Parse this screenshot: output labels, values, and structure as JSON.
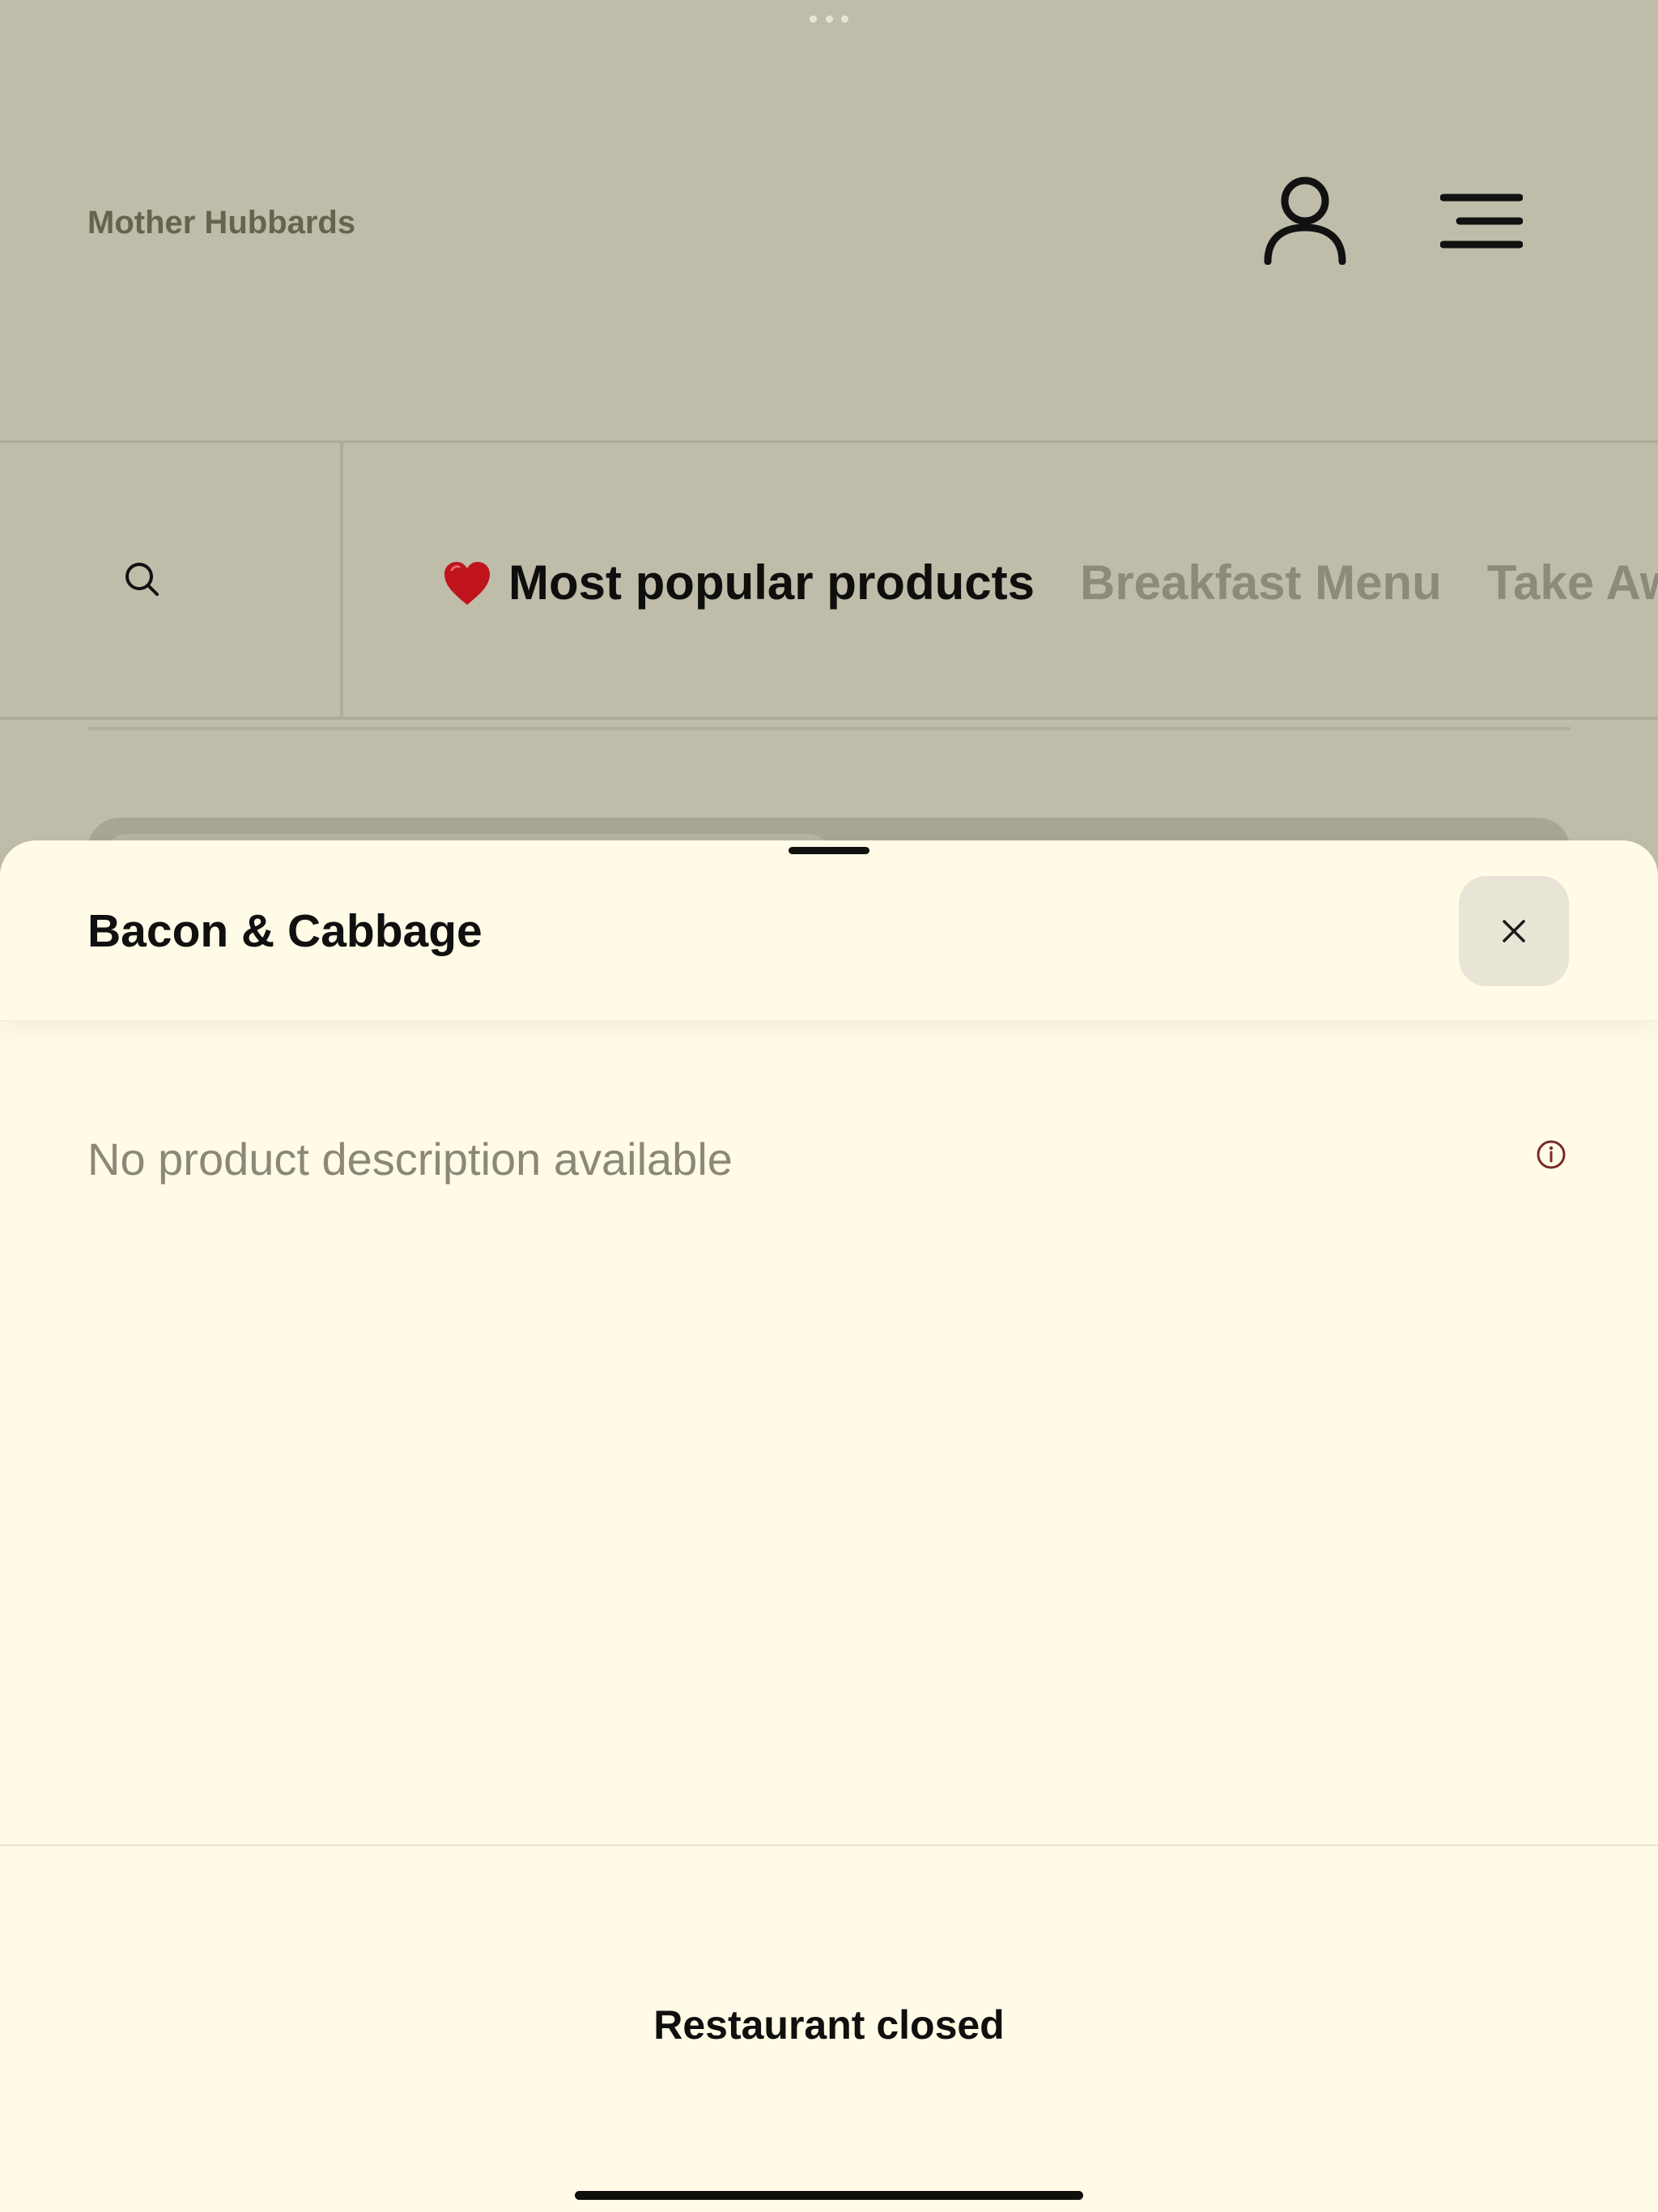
{
  "app": {
    "brand": "Mother Hubbards"
  },
  "categories": [
    {
      "label": "Most popular products",
      "icon": "heart-icon",
      "active": true
    },
    {
      "label": "Breakfast Menu",
      "active": false
    },
    {
      "label": "Take Away",
      "active": false
    }
  ],
  "product_sheet": {
    "title": "Bacon & Cabbage",
    "description": "No product description available",
    "status": "Restaurant closed"
  },
  "colors": {
    "background_dimmed": "#bfbcaa",
    "sheet_background": "#fffbe6",
    "close_button": "#e8e5d6",
    "heart": "#c0141c",
    "info_icon": "#7a2a24"
  }
}
